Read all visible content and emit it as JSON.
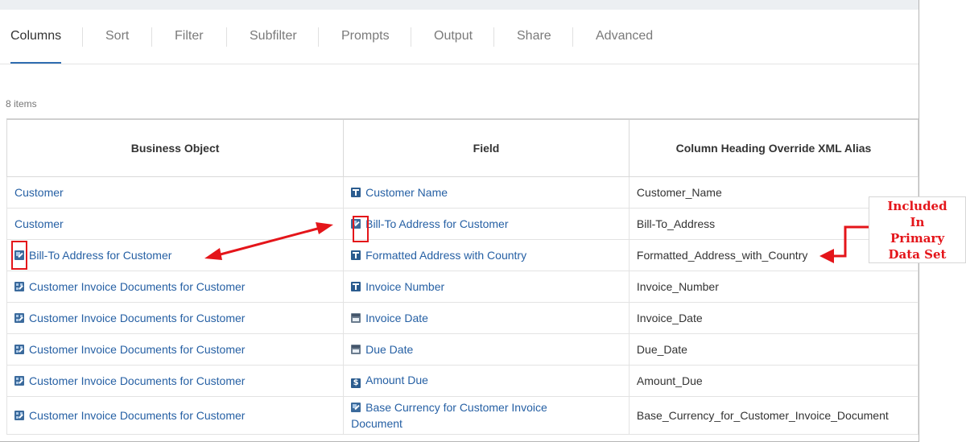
{
  "tabs": [
    {
      "label": "Columns",
      "active": true
    },
    {
      "label": "Sort"
    },
    {
      "label": "Filter"
    },
    {
      "label": "Subfilter"
    },
    {
      "label": "Prompts"
    },
    {
      "label": "Output"
    },
    {
      "label": "Share"
    },
    {
      "label": "Advanced"
    }
  ],
  "item_count": "8 items",
  "table": {
    "headers": [
      "Business Object",
      "Field",
      "Column Heading Override XML Alias"
    ],
    "rows": [
      {
        "business_object": "Customer",
        "bo_icon": "none",
        "field": "Customer Name",
        "field_icon": "text-field-icon",
        "alias": "Customer_Name"
      },
      {
        "business_object": "Customer",
        "bo_icon": "none",
        "field": "Bill-To Address for Customer",
        "field_icon": "instance-field-icon",
        "alias": "Bill-To_Address"
      },
      {
        "business_object": "Bill-To Address for Customer",
        "bo_icon": "single-instance-icon",
        "field": "Formatted Address with Country",
        "field_icon": "text-field-icon",
        "alias": "Formatted_Address_with_Country"
      },
      {
        "business_object": "Customer Invoice Documents for Customer",
        "bo_icon": "multi-instance-icon",
        "field": "Invoice Number",
        "field_icon": "text-field-icon",
        "alias": "Invoice_Number"
      },
      {
        "business_object": "Customer Invoice Documents for Customer",
        "bo_icon": "multi-instance-icon",
        "field": "Invoice Date",
        "field_icon": "date-field-icon",
        "alias": "Invoice_Date"
      },
      {
        "business_object": "Customer Invoice Documents for Customer",
        "bo_icon": "multi-instance-icon",
        "field": "Due Date",
        "field_icon": "date-field-icon",
        "alias": "Due_Date"
      },
      {
        "business_object": "Customer Invoice Documents for Customer",
        "bo_icon": "multi-instance-icon",
        "field": "Amount Due",
        "field_icon": "currency-field-icon",
        "alias": "Amount_Due"
      },
      {
        "business_object": "Customer Invoice Documents for Customer",
        "bo_icon": "multi-instance-icon",
        "field": "Base Currency for Customer Invoice",
        "field_line2": "Document",
        "field_icon": "instance-field-icon",
        "alias": "Base_Currency_for_Customer_Invoice_Document"
      }
    ]
  },
  "callout": {
    "lines": [
      "Included",
      "In",
      "Primary",
      "Data Set"
    ]
  },
  "colors": {
    "link": "#2660a4",
    "accent": "#2f6db1",
    "annotation": "#e4151a"
  },
  "currency_icon_glyph": "$"
}
